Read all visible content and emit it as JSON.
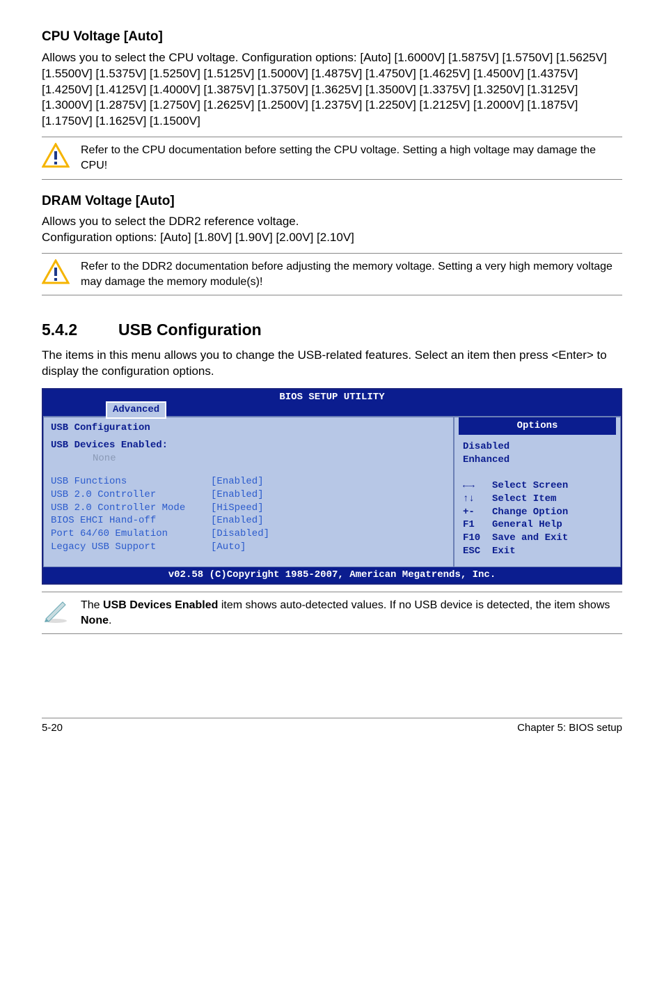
{
  "section1": {
    "heading": "CPU Voltage [Auto]",
    "body": "Allows you to select the CPU voltage. Configuration options: [Auto] [1.6000V] [1.5875V] [1.5750V] [1.5625V] [1.5500V] [1.5375V] [1.5250V] [1.5125V] [1.5000V] [1.4875V] [1.4750V] [1.4625V] [1.4500V] [1.4375V] [1.4250V] [1.4125V] [1.4000V] [1.3875V] [1.3750V] [1.3625V] [1.3500V] [1.3375V] [1.3250V] [1.3125V] [1.3000V] [1.2875V] [1.2750V] [1.2625V] [1.2500V] [1.2375V] [1.2250V] [1.2125V] [1.2000V] [1.1875V] [1.1750V] [1.1625V] [1.1500V]",
    "callout": "Refer to the CPU documentation before setting the CPU voltage. Setting a high voltage may damage the CPU!"
  },
  "section2": {
    "heading": "DRAM Voltage [Auto]",
    "body_line1": "Allows you to select the DDR2 reference voltage.",
    "body_line2": "Configuration options: [Auto] [1.80V]  [1.90V] [2.00V] [2.10V]",
    "callout": "Refer to the DDR2 documentation before adjusting the memory voltage. Setting a very high memory voltage may damage the memory module(s)!"
  },
  "section3": {
    "number": "5.4.2",
    "title": "USB Configuration",
    "intro": "The items in this menu allows you to change the USB-related features. Select an item then press <Enter> to display the configuration options."
  },
  "bios": {
    "title": "BIOS SETUP UTILITY",
    "tab": "Advanced",
    "panel_title": "USB Configuration",
    "devices_label": "USB Devices Enabled:",
    "devices_value": "None",
    "rows": [
      {
        "label": "USB Functions",
        "value": "[Enabled]"
      },
      {
        "label": "USB 2.0 Controller",
        "value": "[Enabled]"
      },
      {
        "label": "USB 2.0 Controller Mode",
        "value": "[HiSpeed]"
      },
      {
        "label": "BIOS EHCI Hand-off",
        "value": "[Enabled]"
      },
      {
        "label": "Port 64/60 Emulation",
        "value": "[Disabled]"
      },
      {
        "label": "Legacy USB Support",
        "value": "[Auto]"
      }
    ],
    "options_header": "Options",
    "options": [
      "Disabled",
      "Enhanced"
    ],
    "hints": [
      {
        "key": "←→",
        "text": "Select Screen"
      },
      {
        "key": "↑↓",
        "text": "Select Item"
      },
      {
        "key": "+-",
        "text": "Change Option"
      },
      {
        "key": "F1",
        "text": "General Help"
      },
      {
        "key": "F10",
        "text": "Save and Exit"
      },
      {
        "key": "ESC",
        "text": "Exit"
      }
    ],
    "footer": "v02.58 (C)Copyright 1985-2007, American Megatrends, Inc."
  },
  "note": {
    "prefix": "The ",
    "bold1": "USB Devices Enabled",
    "mid": " item shows auto-detected values. If no USB device is detected, the item shows ",
    "bold2": "None",
    "suffix": "."
  },
  "footer": {
    "page": "5-20",
    "chapter": "Chapter 5: BIOS setup"
  }
}
